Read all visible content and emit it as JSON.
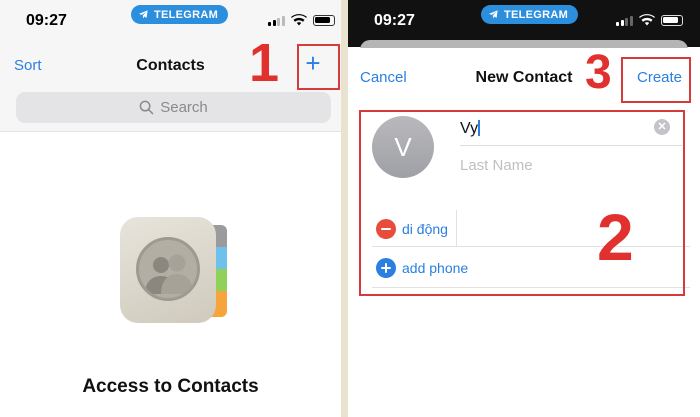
{
  "status_bar": {
    "time": "09:27",
    "telegram_label": "TELEGRAM"
  },
  "left_screen": {
    "nav": {
      "sort_label": "Sort",
      "title": "Contacts",
      "add_label": "+"
    },
    "search": {
      "placeholder": "Search"
    },
    "empty_state": {
      "heading": "Access to Contacts"
    }
  },
  "right_screen": {
    "nav": {
      "cancel_label": "Cancel",
      "title": "New Contact",
      "create_label": "Create"
    },
    "avatar_initial": "V",
    "first_name_value": "Vy",
    "last_name_placeholder": "Last Name",
    "phone_label": "di động",
    "add_phone_label": "add phone"
  },
  "annotations": [
    "1",
    "2",
    "3"
  ],
  "colors": {
    "ios_blue": "#2a7fe0",
    "annotation_red": "#d63a3a",
    "telegram_blue": "#2b8fde",
    "delete_red": "#e74c3c"
  }
}
